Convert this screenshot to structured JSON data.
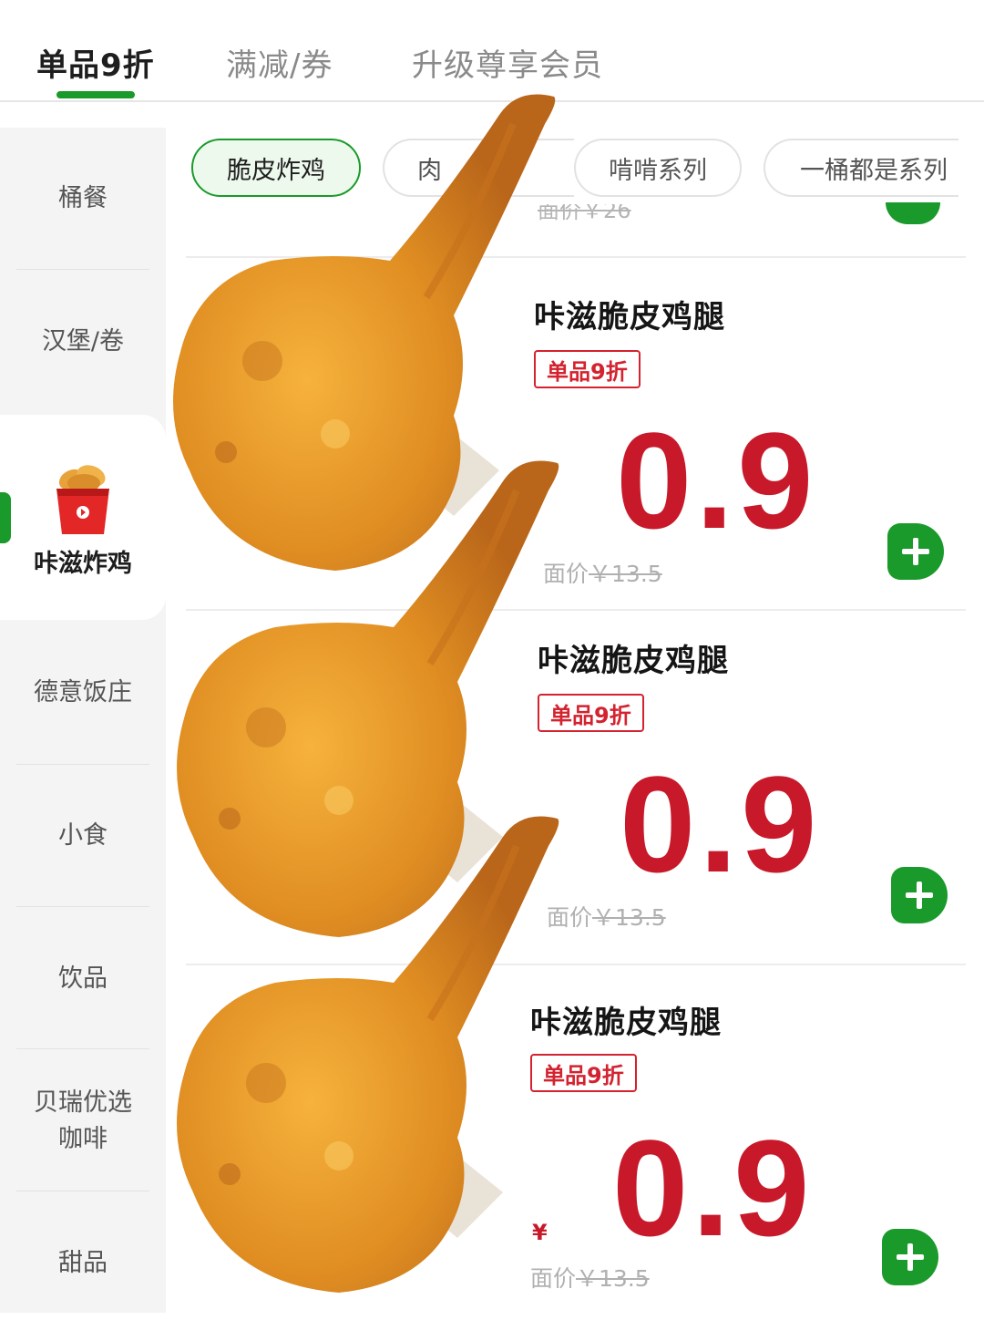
{
  "tabs": [
    {
      "label": "单品9折",
      "active": true
    },
    {
      "label": "满减/券",
      "active": false
    },
    {
      "label": "升级尊享会员",
      "active": false
    }
  ],
  "sidebar": {
    "items": [
      {
        "label": "桶餐"
      },
      {
        "label": "汉堡/卷"
      },
      {
        "label": "咔滋炸鸡",
        "active": true,
        "icon": "chicken-bucket-icon"
      },
      {
        "label": "德意饭庄"
      },
      {
        "label": "小食"
      },
      {
        "label": "饮品"
      },
      {
        "label_line1": "贝瑞优选",
        "label_line2": "咖啡"
      },
      {
        "label": "甜品"
      }
    ]
  },
  "chips": [
    {
      "label": "脆皮炸鸡",
      "active": true
    },
    {
      "label": "肉"
    },
    {
      "label": "啃啃系列"
    },
    {
      "label": "一桶都是系列"
    }
  ],
  "peek": {
    "orig_price": "面价￥26"
  },
  "products": [
    {
      "name": "咔滋脆皮鸡腿",
      "badge": "单品9折",
      "price": "0.9",
      "currency": "",
      "orig_prefix": "面价",
      "orig_price": "￥13.5"
    },
    {
      "name": "咔滋脆皮鸡腿",
      "badge": "单品9折",
      "price": "0.9",
      "currency": "",
      "orig_prefix": "面价",
      "orig_price": "￥13.5"
    },
    {
      "name": "咔滋脆皮鸡腿",
      "badge": "单品9折",
      "price": "0.9",
      "currency": "¥",
      "orig_prefix": "面价",
      "orig_price": "￥13.5"
    }
  ],
  "colors": {
    "accent_green": "#1a9a2a",
    "price_red": "#c8192a",
    "badge_red": "#d3232f"
  }
}
